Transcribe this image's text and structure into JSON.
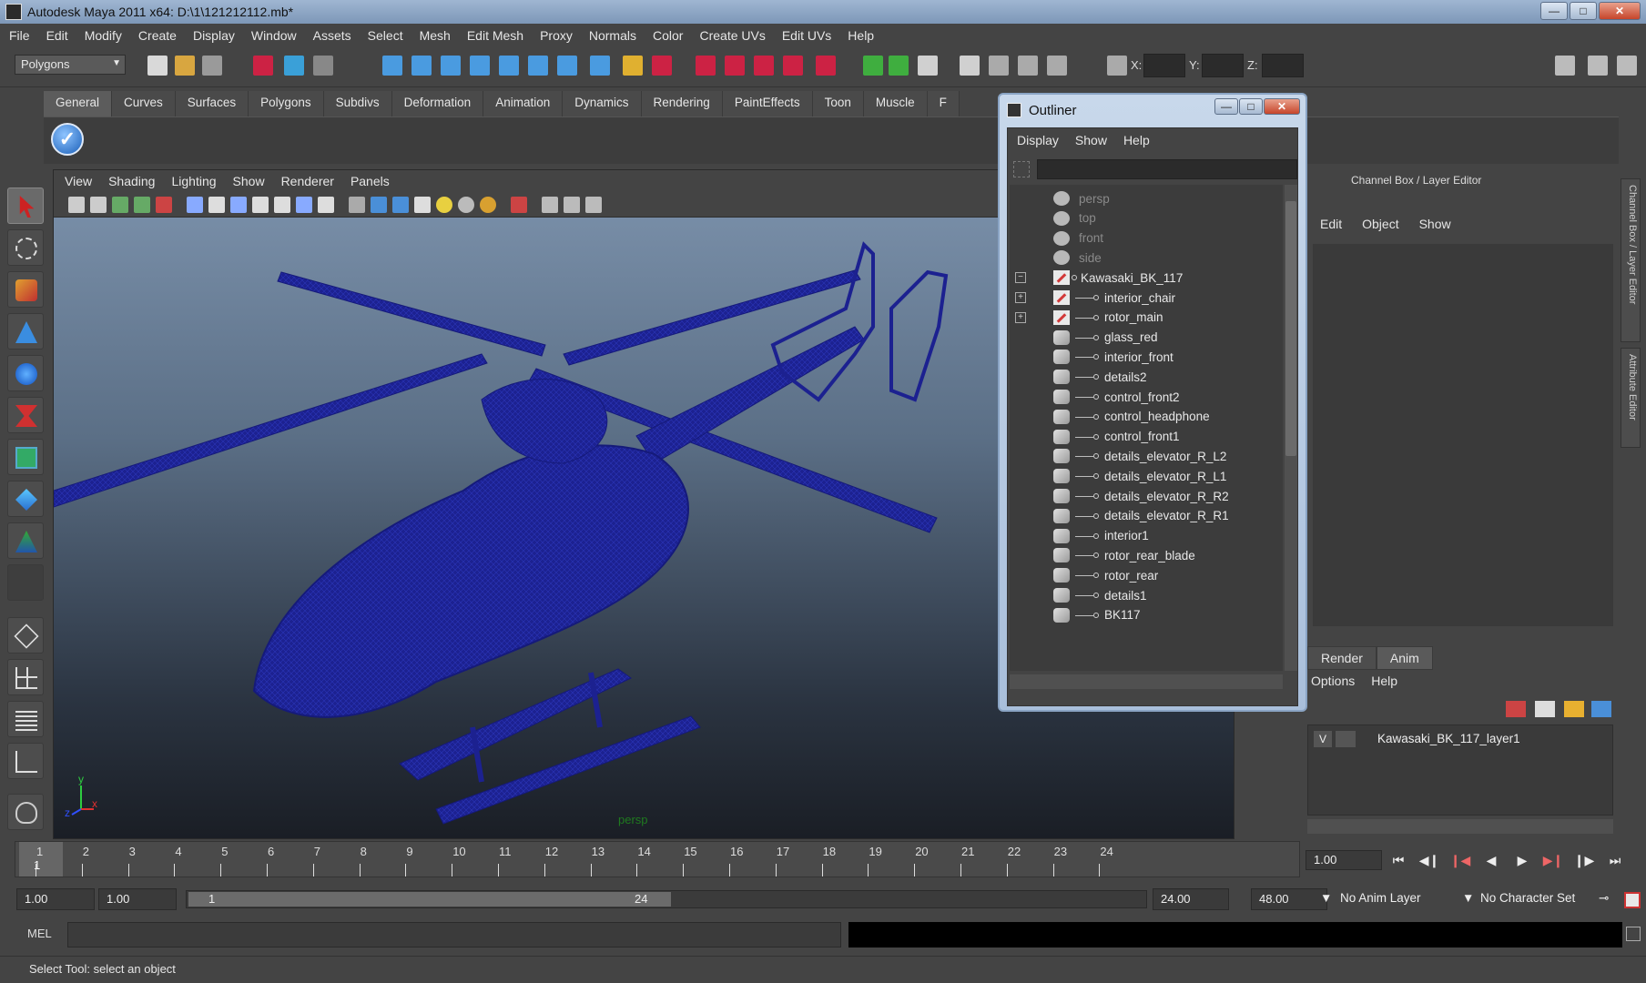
{
  "window": {
    "title": "Autodesk Maya 2011 x64: D:\\1\\121212112.mb*",
    "controls": [
      "minimize",
      "maximize",
      "close"
    ]
  },
  "menubar": [
    "File",
    "Edit",
    "Modify",
    "Create",
    "Display",
    "Window",
    "Assets",
    "Select",
    "Mesh",
    "Edit Mesh",
    "Proxy",
    "Normals",
    "Color",
    "Create UVs",
    "Edit UVs",
    "Help"
  ],
  "statusline": {
    "mode": "Polygons",
    "x_label": "X:",
    "y_label": "Y:",
    "z_label": "Z:"
  },
  "shelf": {
    "tabs": [
      "General",
      "Curves",
      "Surfaces",
      "Polygons",
      "Subdivs",
      "Deformation",
      "Animation",
      "Dynamics",
      "Rendering",
      "PaintEffects",
      "Toon",
      "Muscle",
      "F"
    ],
    "active_tab": "General",
    "check_icon": "check-circle-icon"
  },
  "viewport": {
    "menu": [
      "View",
      "Shading",
      "Lighting",
      "Show",
      "Renderer",
      "Panels"
    ],
    "camera_label": "persp",
    "axis_labels": {
      "x": "x",
      "y": "y",
      "z": "z"
    },
    "wireframe_color": "#1a1f8a"
  },
  "outliner": {
    "title": "Outliner",
    "menu": [
      "Display",
      "Show",
      "Help"
    ],
    "items": [
      {
        "label": "persp",
        "icon": "camera-icon",
        "dim": true,
        "depth": 0
      },
      {
        "label": "top",
        "icon": "camera-icon",
        "dim": true,
        "depth": 0
      },
      {
        "label": "front",
        "icon": "camera-icon",
        "dim": true,
        "depth": 0
      },
      {
        "label": "side",
        "icon": "camera-icon",
        "dim": true,
        "depth": 0
      },
      {
        "label": "Kawasaki_BK_117",
        "icon": "group-icon",
        "expander": "−",
        "depth": 0
      },
      {
        "label": "interior_chair",
        "icon": "group-icon",
        "expander": "+",
        "depth": 1
      },
      {
        "label": "rotor_main",
        "icon": "group-icon",
        "expander": "+",
        "depth": 1
      },
      {
        "label": "glass_red",
        "icon": "mesh-icon",
        "depth": 1
      },
      {
        "label": "interior_front",
        "icon": "mesh-icon",
        "depth": 1
      },
      {
        "label": "details2",
        "icon": "mesh-icon",
        "depth": 1
      },
      {
        "label": "control_front2",
        "icon": "mesh-icon",
        "depth": 1
      },
      {
        "label": "control_headphone",
        "icon": "mesh-icon",
        "depth": 1
      },
      {
        "label": "control_front1",
        "icon": "mesh-icon",
        "depth": 1
      },
      {
        "label": "details_elevator_R_L2",
        "icon": "mesh-icon",
        "depth": 1
      },
      {
        "label": "details_elevator_R_L1",
        "icon": "mesh-icon",
        "depth": 1
      },
      {
        "label": "details_elevator_R_R2",
        "icon": "mesh-icon",
        "depth": 1
      },
      {
        "label": "details_elevator_R_R1",
        "icon": "mesh-icon",
        "depth": 1
      },
      {
        "label": "interior1",
        "icon": "mesh-icon",
        "depth": 1
      },
      {
        "label": "rotor_rear_blade",
        "icon": "mesh-icon",
        "depth": 1
      },
      {
        "label": "rotor_rear",
        "icon": "mesh-icon",
        "depth": 1
      },
      {
        "label": "details1",
        "icon": "mesh-icon",
        "depth": 1
      },
      {
        "label": "BK117",
        "icon": "mesh-icon",
        "depth": 1
      }
    ]
  },
  "channelbox": {
    "header": "Channel Box / Layer Editor",
    "menu": [
      "Edit",
      "Object",
      "Show"
    ],
    "side_tabs": [
      "Channel Box / Layer Editor",
      "Attribute Editor"
    ]
  },
  "layers": {
    "tabs": [
      "Render",
      "Anim"
    ],
    "menu": [
      "Options",
      "Help"
    ],
    "rows": [
      {
        "visible": "V",
        "name": "Kawasaki_BK_117_layer1"
      }
    ]
  },
  "timeline": {
    "frames": [
      "1",
      "2",
      "3",
      "4",
      "5",
      "6",
      "7",
      "8",
      "9",
      "10",
      "11",
      "12",
      "13",
      "14",
      "15",
      "16",
      "17",
      "18",
      "19",
      "20",
      "21",
      "22",
      "23",
      "24"
    ],
    "current_frame_marker": "1",
    "current_frame": "1.00"
  },
  "range": {
    "start": "1.00",
    "playback_start": "1.00",
    "handle_start": "1",
    "handle_end": "24",
    "playback_end": "24.00",
    "end": "48.00",
    "anim_layer": "No Anim Layer",
    "character_set": "No Character Set"
  },
  "commandline": {
    "label": "MEL",
    "help": "Select Tool: select an object"
  }
}
